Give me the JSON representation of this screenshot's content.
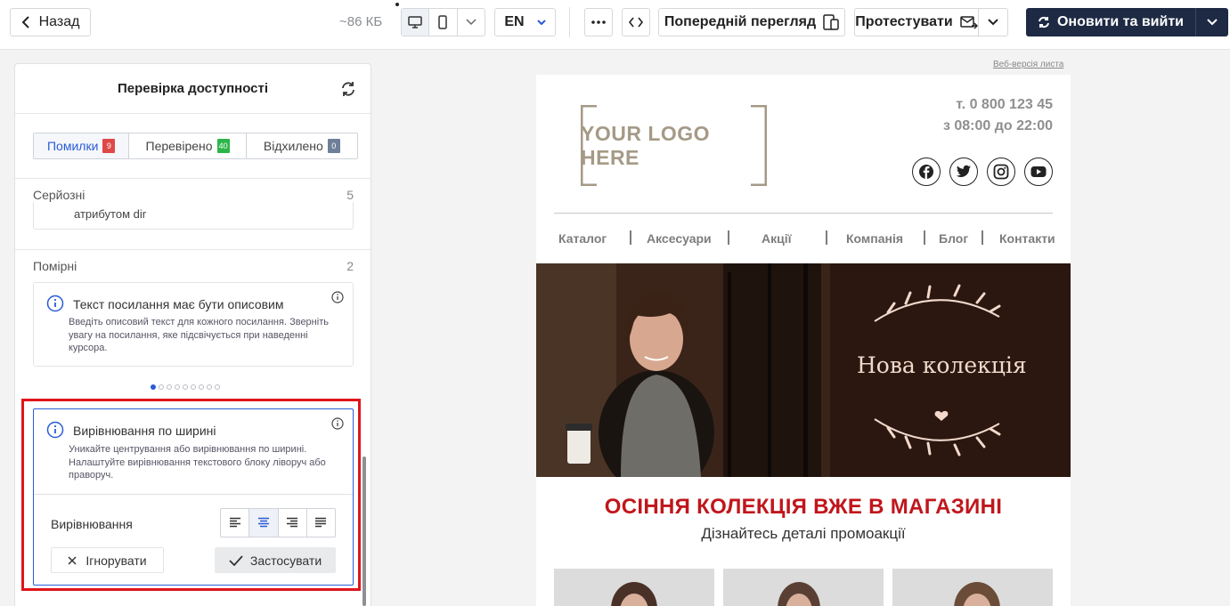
{
  "toolbar": {
    "back_label": "Назад",
    "size": "~86 КБ",
    "lang": "EN",
    "preview_label": "Попередній перегляд",
    "test_label": "Протестувати",
    "update_label": "Оновити та вийти"
  },
  "panel": {
    "title": "Перевірка доступності",
    "tabs": [
      {
        "label": "Помилки",
        "count": "9"
      },
      {
        "label": "Перевірено",
        "count": "40"
      },
      {
        "label": "Відхилено",
        "count": "0"
      }
    ],
    "serious": {
      "label": "Серйозні",
      "count": "5",
      "partial_text": "атрибутом dir"
    },
    "minor": {
      "label": "Помірні",
      "count": "2"
    },
    "issue": {
      "title": "Текст посилання має бути описовим",
      "description": "Введіть описовий текст для кожного посилання. Зверніть увагу на посилання, яке підсвічується при наведенні курсора."
    },
    "pager": {
      "total": 9,
      "active": 1
    },
    "align_issue": {
      "title": "Вирівнювання по ширині",
      "description": "Уникайте центрування або вирівнювання по ширині. Налаштуйте вирівнювання текстового блоку ліворуч або праворуч.",
      "align_label": "Вирівнювання",
      "options": [
        "left",
        "center",
        "right",
        "justify"
      ],
      "selected": "center",
      "ignore_label": "Ігнорувати",
      "apply_label": "Застосувати"
    }
  },
  "email": {
    "web_version": "Веб-версія листа",
    "logo_text": "YOUR LOGO HERE",
    "phone_line1": "т. 0 800 123 45",
    "phone_line2": "з 08:00 до 22:00",
    "socials": [
      "facebook-icon",
      "twitter-icon",
      "instagram-icon",
      "youtube-icon"
    ],
    "menu": [
      "Каталог",
      "Аксесуари",
      "Акції",
      "Компанія",
      "Блог",
      "Контакти"
    ],
    "hero_title": "Нова колекція",
    "headline": "ОСІННЯ КОЛЕКЦІЯ ВЖЕ В МАГАЗИНІ",
    "subline": "Дізнайтесь деталі промоакції"
  },
  "colors": {
    "accent": "#2a5bd7",
    "primary_button": "#1e2a44",
    "highlight": "#e0141b",
    "headline": "#c0161c"
  }
}
